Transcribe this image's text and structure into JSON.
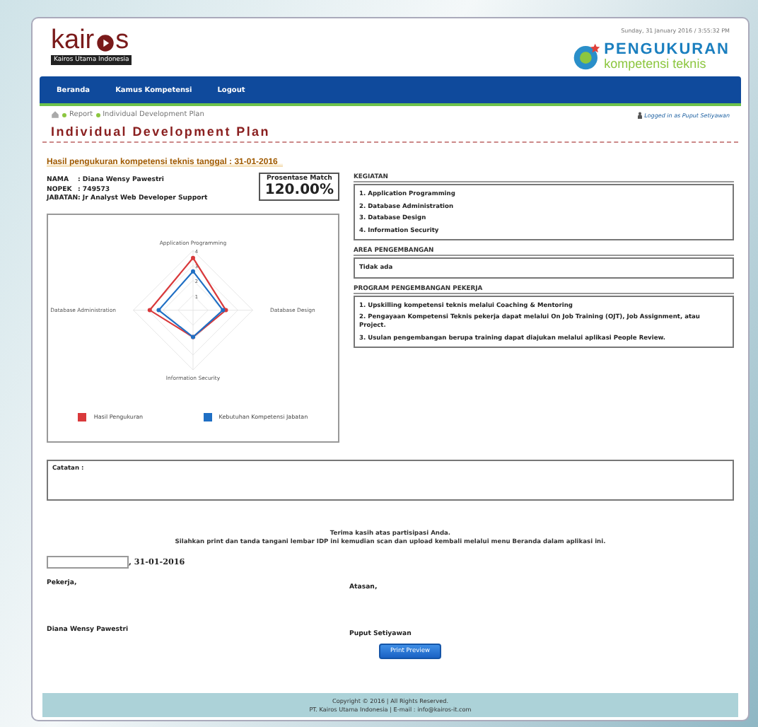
{
  "header": {
    "logo_text": "kair",
    "logo_text_end": "s",
    "logo_tagline": "Kairos Utama Indonesia",
    "brand_line1": "PENGUKURAN",
    "brand_line2": "kompetensi teknis",
    "datetime": "Sunday, 31 January 2016 / 3:55:32 PM"
  },
  "nav": [
    {
      "label": "Beranda"
    },
    {
      "label": "Kamus Kompetensi"
    },
    {
      "label": "Logout"
    }
  ],
  "breadcrumb": [
    "Report",
    "Individual Development Plan"
  ],
  "logged_in": "Logged in as Puput Setiyawan",
  "page_title": "Individual Development Plan",
  "result_heading": "Hasil pengukuran kompetensi teknis tanggal : 31-01-2016",
  "employee": [
    {
      "label": "NAMA",
      "value": ": Diana Wensy Pawestri"
    },
    {
      "label": "NOPEK",
      "value": ": 749573"
    },
    {
      "label": "JABATAN",
      "value": ": Jr Analyst Web Developer Support"
    }
  ],
  "match": {
    "label": "Prosentase Match",
    "value": "120.00%"
  },
  "radar": {
    "axes": [
      "Application Programming",
      "Database Design",
      "Information Security",
      "Database Administration"
    ],
    "ticks": [
      "4",
      "3",
      "2",
      "1"
    ],
    "legend": [
      {
        "name": "Hasil Pengukuran",
        "color": "#d9393b"
      },
      {
        "name": "Kebutuhan Kompetensi Jabatan",
        "color": "#1f6fc4"
      }
    ]
  },
  "sections": [
    {
      "title": "KEGIATAN",
      "items": [
        "1. Application Programming",
        "2. Database Administration",
        "3. Database Design",
        "4. Information Security"
      ]
    },
    {
      "title": "AREA PENGEMBANGAN",
      "items": [
        "Tidak ada"
      ]
    },
    {
      "title": "PROGRAM PENGEMBANGAN PEKERJA",
      "items": [
        "1. Upskilling kompetensi teknis melalui Coaching & Mentoring",
        "2. Pengayaan Kompetensi Teknis pekerja dapat melalui On Job Training (OJT), Job Assignment, atau Project.",
        "3. Usulan pengembangan berupa training dapat diajukan melalui aplikasi People Review."
      ]
    }
  ],
  "notes_label": "Catatan :",
  "thanks": [
    "Terima kasih atas partisipasi Anda.",
    "Silahkan print dan tanda tangani lembar IDP ini kemudian scan dan upload kembali melalui menu Beranda dalam aplikasi ini."
  ],
  "date_suffix": ", 31-01-2016",
  "signatures": [
    {
      "role": "Pekerja,",
      "name": "Diana Wensy Pawestri"
    },
    {
      "role": "Atasan,",
      "name": "Puput Setiyawan"
    }
  ],
  "print_button": "Print Preview",
  "footer": [
    "Copyright © 2016 | All Rights Reserved.",
    "PT. Kairos Utama Indonesia | E-mail : info@kairos-it.com"
  ]
}
